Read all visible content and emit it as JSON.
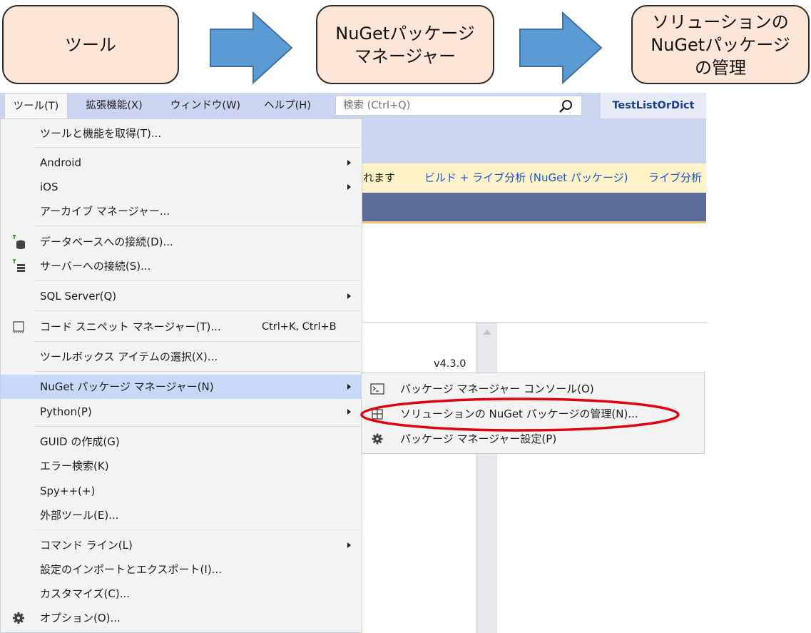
{
  "flow": {
    "steps": [
      "ツール",
      "NuGetパッケージ\nマネージャー",
      "ソリューションの\nNuGetパッケージ\nの管理"
    ]
  },
  "menubar": {
    "items": [
      "ツール(T)",
      "拡張機能(X)",
      "ウィンドウ(W)",
      "ヘルプ(H)"
    ],
    "search_placeholder": "検索 (Ctrl+Q)",
    "project_name": "TestListOrDict"
  },
  "infobar": {
    "text": "れます",
    "link1": "ビルド + ライブ分析 (NuGet パッケージ)",
    "link2": "ライブ分析"
  },
  "version_label": "v4.3.0",
  "tools_menu": {
    "items": [
      {
        "label": "ツールと機能を取得(T)..."
      },
      {
        "label": "Android"
      },
      {
        "label": "iOS"
      },
      {
        "label": "アーカイブ マネージャー..."
      },
      {
        "label": "データベースへの接続(D)..."
      },
      {
        "label": "サーバーへの接続(S)..."
      },
      {
        "label": "SQL Server(Q)"
      },
      {
        "label": "コード スニペット マネージャー(T)...",
        "shortcut": "Ctrl+K, Ctrl+B"
      },
      {
        "label": "ツールボックス アイテムの選択(X)..."
      },
      {
        "label": "NuGet パッケージ マネージャー(N)"
      },
      {
        "label": "Python(P)"
      },
      {
        "label": "GUID の作成(G)"
      },
      {
        "label": "エラー検索(K)"
      },
      {
        "label": "Spy++(+)"
      },
      {
        "label": "外部ツール(E)..."
      },
      {
        "label": "コマンド ライン(L)"
      },
      {
        "label": "設定のインポートとエクスポート(I)..."
      },
      {
        "label": "カスタマイズ(C)..."
      },
      {
        "label": "オプション(O)..."
      }
    ]
  },
  "nuget_submenu": {
    "items": [
      {
        "label": "パッケージ マネージャー コンソール(O)"
      },
      {
        "label": "ソリューションの NuGet パッケージの管理(N)..."
      },
      {
        "label": "パッケージ マネージャー設定(P)"
      }
    ]
  },
  "colors": {
    "flow_box_fill": "#fbe5d6",
    "arrow_fill": "#5b9bd5",
    "menubar": "#ccd5f0",
    "menu_highlight": "#c9d7f8",
    "callout_ellipse": "#e3000f"
  }
}
